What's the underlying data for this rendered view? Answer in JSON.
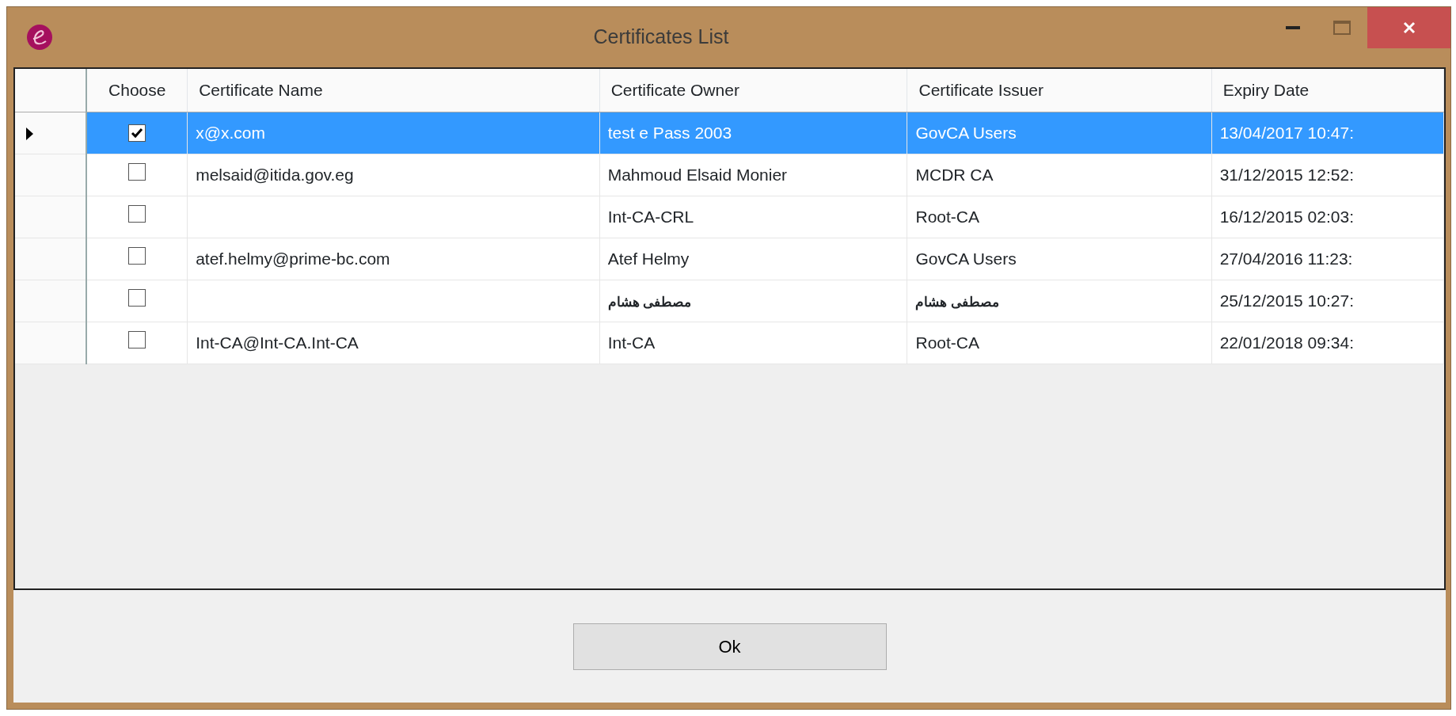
{
  "window": {
    "title": "Certificates List"
  },
  "table": {
    "columns": [
      "Choose",
      "Certificate Name",
      "Certificate Owner",
      "Certificate Issuer",
      "Expiry Date"
    ],
    "rows": [
      {
        "selected": true,
        "checked": true,
        "name": "x@x.com",
        "owner": "test e Pass 2003",
        "issuer": "GovCA Users",
        "expiry": "13/04/2017 10:47:"
      },
      {
        "selected": false,
        "checked": false,
        "name": "melsaid@itida.gov.eg",
        "owner": "Mahmoud Elsaid Monier",
        "issuer": "MCDR CA",
        "expiry": "31/12/2015 12:52:"
      },
      {
        "selected": false,
        "checked": false,
        "owner": "Int-CA-CRL",
        "issuer": "Root-CA",
        "expiry": "16/12/2015 02:03:"
      },
      {
        "selected": false,
        "checked": false,
        "name": "atef.helmy@prime-bc.com",
        "owner": "Atef Helmy",
        "issuer": "GovCA Users",
        "expiry": "27/04/2016 11:23:"
      },
      {
        "selected": false,
        "checked": false,
        "owner": "مصطفى هشام",
        "issuer": "مصطفى هشام",
        "expiry": "25/12/2015 10:27:"
      },
      {
        "selected": false,
        "checked": false,
        "name": "Int-CA@Int-CA.Int-CA",
        "owner": "Int-CA",
        "issuer": "Root-CA",
        "expiry": "22/01/2018 09:34:"
      }
    ]
  },
  "buttons": [
    "Ok"
  ]
}
